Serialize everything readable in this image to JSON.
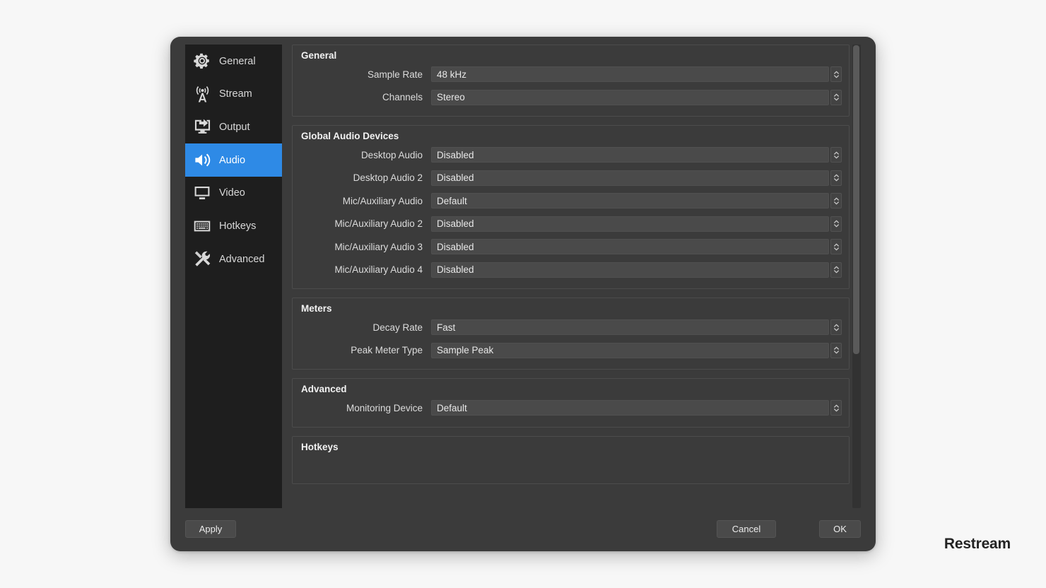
{
  "sidebar": {
    "items": [
      {
        "label": "General",
        "icon": "gear-icon",
        "active": false
      },
      {
        "label": "Stream",
        "icon": "broadcast-icon",
        "active": false
      },
      {
        "label": "Output",
        "icon": "output-icon",
        "active": false
      },
      {
        "label": "Audio",
        "icon": "speaker-icon",
        "active": true
      },
      {
        "label": "Video",
        "icon": "monitor-icon",
        "active": false
      },
      {
        "label": "Hotkeys",
        "icon": "keyboard-icon",
        "active": false
      },
      {
        "label": "Advanced",
        "icon": "tools-icon",
        "active": false
      }
    ]
  },
  "groups": [
    {
      "title": "General",
      "rows": [
        {
          "label": "Sample Rate",
          "value": "48 kHz"
        },
        {
          "label": "Channels",
          "value": "Stereo"
        }
      ]
    },
    {
      "title": "Global Audio Devices",
      "rows": [
        {
          "label": "Desktop Audio",
          "value": "Disabled"
        },
        {
          "label": "Desktop Audio 2",
          "value": "Disabled"
        },
        {
          "label": "Mic/Auxiliary Audio",
          "value": "Default"
        },
        {
          "label": "Mic/Auxiliary Audio 2",
          "value": "Disabled"
        },
        {
          "label": "Mic/Auxiliary Audio 3",
          "value": "Disabled"
        },
        {
          "label": "Mic/Auxiliary Audio 4",
          "value": "Disabled"
        }
      ]
    },
    {
      "title": "Meters",
      "rows": [
        {
          "label": "Decay Rate",
          "value": "Fast"
        },
        {
          "label": "Peak Meter Type",
          "value": "Sample Peak"
        }
      ]
    },
    {
      "title": "Advanced",
      "rows": [
        {
          "label": "Monitoring Device",
          "value": "Default"
        }
      ]
    },
    {
      "title": "Hotkeys",
      "rows": []
    }
  ],
  "footer": {
    "apply_label": "Apply",
    "cancel_label": "Cancel",
    "ok_label": "OK"
  },
  "watermark": {
    "text": "Restream"
  },
  "colors": {
    "accent": "#2e8ae6",
    "sidebar_bg": "#1e1e1e",
    "window_bg": "#3b3b3b",
    "field_bg": "#4a4a4a"
  }
}
